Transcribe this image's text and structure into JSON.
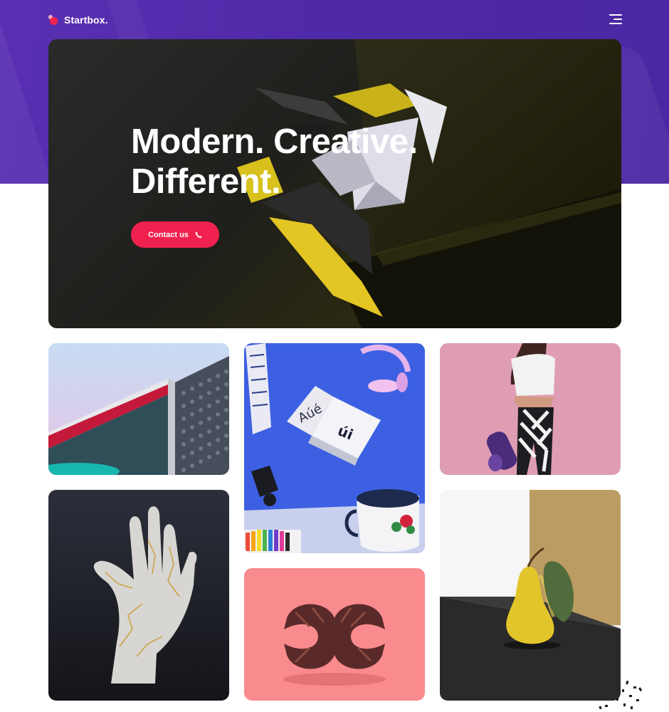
{
  "header": {
    "brand": "Startbox.",
    "logo_icon": "startbox-logo-icon",
    "menu_icon": "hamburger-menu-icon",
    "band_color": "#5230ad"
  },
  "hero": {
    "title_line1": "Modern. Creative.",
    "title_line2": "Different.",
    "cta_label": "Contact us",
    "cta_icon": "phone-icon",
    "cta_color": "#f0214e"
  },
  "gallery": {
    "images": [
      {
        "name": "building-image",
        "subject": "modern building facade"
      },
      {
        "name": "typography-book-image",
        "subject": "floating book and headphones"
      },
      {
        "name": "yoga-woman-image",
        "subject": "woman holding yoga mat"
      },
      {
        "name": "kintsugi-hand-image",
        "subject": "cracked sculpted hand"
      },
      {
        "name": "pretzel-donut-image",
        "subject": "chocolate pastry sculpture"
      },
      {
        "name": "pear-image",
        "subject": "yellow pear on table"
      }
    ]
  }
}
